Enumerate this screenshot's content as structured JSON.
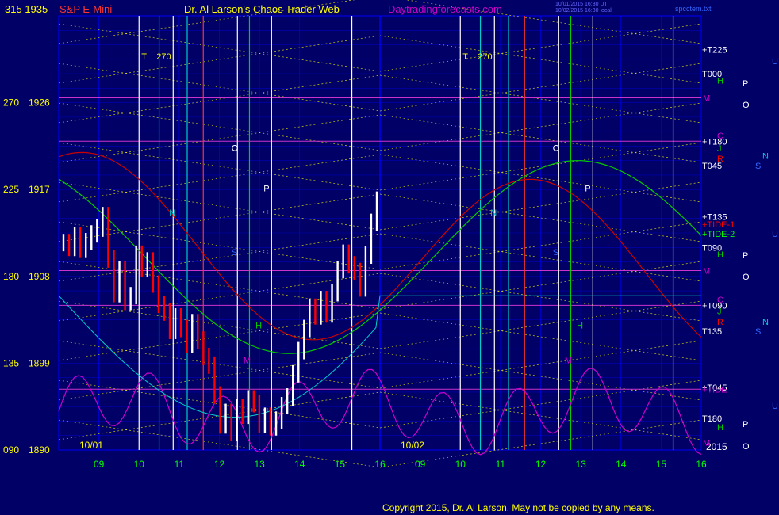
{
  "header": {
    "instrument": "S&P E-Mini",
    "site_title": "Dr. Al Larson's Chaos Trader Web",
    "site_url": "Daytradingforecasts.com",
    "timestamp_line1": "10/01/2015 16:30 UT",
    "timestamp_line2": "10/02/2015 16:30 local",
    "file_name": "spcctem.txt"
  },
  "copyright": "Copyright 2015, Dr. Al Larson. May not be copied by any means.",
  "colors": {
    "background": "#000066",
    "grid": "#0000ff",
    "price_up": "#ffffff",
    "price_down": "#ff0000",
    "fib_lines": "#ffff00",
    "tide1": "#cc0000",
    "tide2": "#00cc00",
    "tide3": "#cc00cc",
    "ma_cyan": "#00cccc",
    "ma_yellow": "#cccc00"
  },
  "chart_data": {
    "type": "candlestick",
    "ylim": [
      1890,
      1935
    ],
    "y_ticks": [
      {
        "deg": "090",
        "price": "1890",
        "value": 1890
      },
      {
        "deg": "135",
        "price": "1899",
        "value": 1899
      },
      {
        "deg": "180",
        "price": "1908",
        "value": 1908
      },
      {
        "deg": "225",
        "price": "1917",
        "value": 1917
      },
      {
        "deg": "270",
        "price": "1926",
        "value": 1926
      },
      {
        "deg": "315",
        "price": "1935",
        "value": 1935
      }
    ],
    "x_hours": [
      "09",
      "10",
      "11",
      "12",
      "13",
      "14",
      "15",
      "16",
      "09",
      "10",
      "11",
      "12",
      "13",
      "14",
      "15",
      "16"
    ],
    "dates": [
      {
        "label": "10/01",
        "slot": 0
      },
      {
        "label": "10/02",
        "slot": 8
      }
    ],
    "year_label": "2015",
    "price_close": [
      1911.5,
      1911.0,
      1912.2,
      1910.8,
      1911.6,
      1912.4,
      1913.0,
      1914.3,
      1909.8,
      1906.2,
      1908.7,
      1905.4,
      1906.0,
      1910.3,
      1908.8,
      1909.6,
      1907.2,
      1905.1,
      1904.3,
      1902.4,
      1903.8,
      1902.6,
      1901.0,
      1903.2,
      1901.4,
      1899.7,
      1898.8,
      1895.7,
      1892.6,
      1893.9,
      1891.8,
      1894.4,
      1893.6,
      1895.3,
      1894.8,
      1892.7,
      1893.5,
      1892.4,
      1893.1,
      1894.6,
      1895.5,
      1897.9,
      1900.3,
      1902.6,
      1904.8,
      1903.9,
      1905.6,
      1904.1,
      1906.3,
      1908.7,
      1910.4,
      1909.2,
      1908.5,
      1906.8,
      1910.2,
      1913.6,
      1915.9
    ],
    "price_down_mask": [
      0,
      1,
      0,
      1,
      0,
      0,
      0,
      0,
      1,
      1,
      0,
      1,
      0,
      0,
      1,
      0,
      1,
      1,
      1,
      1,
      0,
      1,
      1,
      0,
      1,
      1,
      1,
      1,
      1,
      0,
      1,
      0,
      1,
      0,
      1,
      1,
      0,
      1,
      0,
      0,
      0,
      0,
      0,
      0,
      0,
      1,
      0,
      1,
      0,
      0,
      0,
      1,
      1,
      1,
      0,
      0,
      0
    ],
    "annotations": {
      "vertical_labels_top": [
        "T",
        "270",
        "T",
        "270"
      ],
      "mid_letters": [
        "N",
        "O",
        "P",
        "S",
        "M",
        "H",
        "N",
        "O",
        "P",
        "S",
        "M",
        "H"
      ],
      "right_axis": [
        {
          "label": "+T225",
          "value": 1931.5,
          "color": "#ffffff"
        },
        {
          "label": "T000",
          "value": 1929.0,
          "color": "#ffffff"
        },
        {
          "label": "H",
          "value": 1928.3,
          "color": "#00cc00"
        },
        {
          "label": "M",
          "value": 1926.5,
          "color": "#cc00cc"
        },
        {
          "label": "+T180",
          "value": 1922.0,
          "color": "#ffffff"
        },
        {
          "label": "C",
          "value": 1922.6,
          "color": "#cc00cc"
        },
        {
          "label": "J",
          "value": 1921.3,
          "color": "#00cc00"
        },
        {
          "label": "R",
          "value": 1920.2,
          "color": "#ff0000"
        },
        {
          "label": "T045",
          "value": 1919.5,
          "color": "#ffffff"
        },
        {
          "label": "+T135",
          "value": 1914.2,
          "color": "#ffffff"
        },
        {
          "label": "+TIDE-1",
          "value": 1913.4,
          "color": "#ff0000"
        },
        {
          "label": "+TIDE-2",
          "value": 1912.4,
          "color": "#00ff00"
        },
        {
          "label": "T090",
          "value": 1911.0,
          "color": "#ffffff"
        },
        {
          "label": "H",
          "value": 1910.3,
          "color": "#00cc00"
        },
        {
          "label": "M",
          "value": 1908.6,
          "color": "#cc00cc"
        },
        {
          "label": "+T090",
          "value": 1905.0,
          "color": "#ffffff"
        },
        {
          "label": "C",
          "value": 1905.6,
          "color": "#cc00cc"
        },
        {
          "label": "J",
          "value": 1904.4,
          "color": "#00cc00"
        },
        {
          "label": "R",
          "value": 1903.3,
          "color": "#ff0000"
        },
        {
          "label": "T135",
          "value": 1902.3,
          "color": "#ffffff"
        },
        {
          "label": "+T045",
          "value": 1896.5,
          "color": "#ffffff"
        },
        {
          "label": "+TIDE",
          "value": 1896.3,
          "color": "#cc00cc"
        },
        {
          "label": "T180",
          "value": 1893.3,
          "color": "#ffffff"
        },
        {
          "label": "H",
          "value": 1892.4,
          "color": "#00cc00"
        },
        {
          "label": "M",
          "value": 1890.8,
          "color": "#cc00cc"
        }
      ],
      "far_right": [
        {
          "label": "U",
          "value": 1930.3,
          "color": "#3366ff"
        },
        {
          "label": "P",
          "value": 1928.0,
          "color": "#ffffff"
        },
        {
          "label": "O",
          "value": 1925.8,
          "color": "#ffffff"
        },
        {
          "label": "N",
          "value": 1920.5,
          "color": "#00cccc"
        },
        {
          "label": "S",
          "value": 1919.5,
          "color": "#3366ff"
        },
        {
          "label": "U",
          "value": 1912.4,
          "color": "#3366ff"
        },
        {
          "label": "P",
          "value": 1910.2,
          "color": "#ffffff"
        },
        {
          "label": "O",
          "value": 1908.0,
          "color": "#ffffff"
        },
        {
          "label": "N",
          "value": 1903.3,
          "color": "#00cccc"
        },
        {
          "label": "S",
          "value": 1902.3,
          "color": "#3366ff"
        },
        {
          "label": "U",
          "value": 1894.6,
          "color": "#3366ff"
        },
        {
          "label": "P",
          "value": 1892.7,
          "color": "#ffffff"
        },
        {
          "label": "O",
          "value": 1890.4,
          "color": "#ffffff"
        }
      ]
    }
  }
}
